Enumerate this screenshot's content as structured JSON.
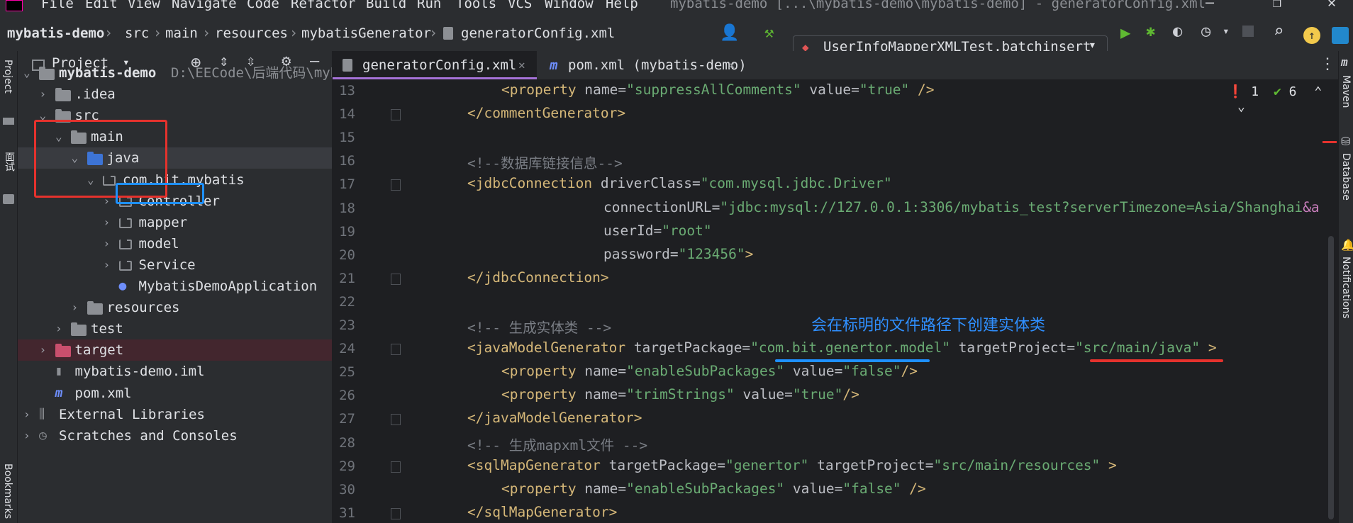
{
  "menu": [
    "File",
    "Edit",
    "View",
    "Navigate",
    "Code",
    "Refactor",
    "Build",
    "Run",
    "Tools",
    "VCS",
    "Window",
    "Help"
  ],
  "window_title": "mybatis-demo [...\\mybatis-demo\\mybatis-demo] - generatorConfig.xml",
  "breadcrumbs": [
    "mybatis-demo",
    "src",
    "main",
    "resources",
    "mybatisGenerator",
    "generatorConfig.xml"
  ],
  "run_config": "UserInfoMapperXMLTest.batchinsert",
  "left_strip": {
    "project": "Project",
    "bookmarks": "Bookmarks",
    "other": "面试"
  },
  "project_panel": {
    "title": "Project",
    "tree": [
      {
        "label": "mybatis-demo",
        "path": "D:\\EECode\\后端代码\\myb",
        "depth": 0,
        "expanded": true,
        "icon": "module-folder-icon"
      },
      {
        "label": ".idea",
        "depth": 1,
        "expanded": false,
        "icon": "folder-icon"
      },
      {
        "label": "src",
        "depth": 1,
        "expanded": true,
        "icon": "folder-icon"
      },
      {
        "label": "main",
        "depth": 2,
        "expanded": true,
        "icon": "folder-icon"
      },
      {
        "label": "java",
        "depth": 3,
        "expanded": true,
        "icon": "source-folder-icon"
      },
      {
        "label": "com.bit.mybatis",
        "depth": 4,
        "expanded": true,
        "icon": "package-icon"
      },
      {
        "label": "Controller",
        "depth": 5,
        "expanded": false,
        "icon": "package-icon"
      },
      {
        "label": "mapper",
        "depth": 5,
        "expanded": false,
        "icon": "package-icon"
      },
      {
        "label": "model",
        "depth": 5,
        "expanded": false,
        "icon": "package-icon"
      },
      {
        "label": "Service",
        "depth": 5,
        "expanded": false,
        "icon": "package-icon"
      },
      {
        "label": "MybatisDemoApplication",
        "depth": 5,
        "expanded": null,
        "icon": "spring-class-icon"
      },
      {
        "label": "resources",
        "depth": 3,
        "expanded": false,
        "icon": "resources-folder-icon"
      },
      {
        "label": "test",
        "depth": 2,
        "expanded": false,
        "icon": "folder-icon"
      },
      {
        "label": "target",
        "depth": 1,
        "expanded": false,
        "icon": "excluded-folder-icon"
      },
      {
        "label": "mybatis-demo.iml",
        "depth": 1,
        "expanded": null,
        "icon": "iml-file-icon"
      },
      {
        "label": "pom.xml",
        "depth": 1,
        "expanded": null,
        "icon": "maven-icon"
      },
      {
        "label": "External Libraries",
        "depth": 0,
        "expanded": false,
        "icon": "libraries-icon"
      },
      {
        "label": "Scratches and Consoles",
        "depth": 0,
        "expanded": false,
        "icon": "scratches-icon"
      }
    ]
  },
  "tabs": [
    {
      "label": "generatorConfig.xml",
      "active": true
    },
    {
      "label": "pom.xml (mybatis-demo)",
      "active": false
    }
  ],
  "inspections": {
    "errors": "1",
    "warnings": "6"
  },
  "code_lines": [
    {
      "n": "13",
      "indent": 2,
      "parts": [
        [
          "t",
          "<property "
        ],
        [
          "a",
          "name="
        ],
        [
          "v",
          "\"suppressAllComments\""
        ],
        [
          "a",
          " value="
        ],
        [
          "v",
          "\"true\""
        ],
        [
          "t",
          " />"
        ]
      ]
    },
    {
      "n": "14",
      "indent": 1,
      "parts": [
        [
          "t",
          "</commentGenerator>"
        ]
      ]
    },
    {
      "n": "15",
      "indent": 0,
      "parts": []
    },
    {
      "n": "16",
      "indent": 1,
      "parts": [
        [
          "c",
          "<!--数据库链接信息-->"
        ]
      ]
    },
    {
      "n": "17",
      "indent": 1,
      "parts": [
        [
          "t",
          "<jdbcConnection "
        ],
        [
          "a",
          "driverClass="
        ],
        [
          "v",
          "\"com.mysql.jdbc.Driver\""
        ]
      ]
    },
    {
      "n": "18",
      "indent": 5,
      "parts": [
        [
          "a",
          "connectionURL="
        ],
        [
          "v",
          "\"jdbc:mysql://127.0.0.1:3306/mybatis_test?serverTimezone=Asia/Shanghai"
        ],
        [
          "e",
          "&a"
        ]
      ]
    },
    {
      "n": "19",
      "indent": 5,
      "parts": [
        [
          "a",
          "userId="
        ],
        [
          "v",
          "\"root\""
        ]
      ]
    },
    {
      "n": "20",
      "indent": 5,
      "parts": [
        [
          "a",
          "password="
        ],
        [
          "v",
          "\"123456\""
        ],
        [
          "t",
          ">"
        ]
      ]
    },
    {
      "n": "21",
      "indent": 1,
      "parts": [
        [
          "t",
          "</jdbcConnection>"
        ]
      ]
    },
    {
      "n": "22",
      "indent": 0,
      "parts": []
    },
    {
      "n": "23",
      "indent": 1,
      "parts": [
        [
          "c",
          "<!-- 生成实体类 -->"
        ]
      ]
    },
    {
      "n": "24",
      "indent": 1,
      "parts": [
        [
          "t",
          "<javaModelGenerator "
        ],
        [
          "a",
          "targetPackage="
        ],
        [
          "v",
          "\"com.bit.genertor.model\""
        ],
        [
          "a",
          " targetProject="
        ],
        [
          "v",
          "\"src/main/java\""
        ],
        [
          "t",
          " >"
        ]
      ]
    },
    {
      "n": "25",
      "indent": 2,
      "parts": [
        [
          "t",
          "<property "
        ],
        [
          "a",
          "name="
        ],
        [
          "v",
          "\"enableSubPackages\""
        ],
        [
          "a",
          " value="
        ],
        [
          "v",
          "\"false\""
        ],
        [
          "t",
          "/>"
        ]
      ]
    },
    {
      "n": "26",
      "indent": 2,
      "parts": [
        [
          "t",
          "<property "
        ],
        [
          "a",
          "name="
        ],
        [
          "v",
          "\"trimStrings\""
        ],
        [
          "a",
          " value="
        ],
        [
          "v",
          "\"true\""
        ],
        [
          "t",
          "/>"
        ]
      ]
    },
    {
      "n": "27",
      "indent": 1,
      "parts": [
        [
          "t",
          "</javaModelGenerator>"
        ]
      ]
    },
    {
      "n": "28",
      "indent": 1,
      "parts": [
        [
          "c",
          "<!-- 生成mapxml文件 -->"
        ]
      ]
    },
    {
      "n": "29",
      "indent": 1,
      "parts": [
        [
          "t",
          "<sqlMapGenerator "
        ],
        [
          "a",
          "targetPackage="
        ],
        [
          "v",
          "\"genertor\""
        ],
        [
          "a",
          " targetProject="
        ],
        [
          "v",
          "\"src/main/resources\""
        ],
        [
          "t",
          " >"
        ]
      ]
    },
    {
      "n": "30",
      "indent": 2,
      "parts": [
        [
          "t",
          "<property "
        ],
        [
          "a",
          "name="
        ],
        [
          "v",
          "\"enableSubPackages\""
        ],
        [
          "a",
          " value="
        ],
        [
          "v",
          "\"false\""
        ],
        [
          "t",
          " />"
        ]
      ]
    },
    {
      "n": "31",
      "indent": 1,
      "parts": [
        [
          "t",
          "</sqlMapGenerator>"
        ]
      ]
    }
  ],
  "annotation_text": "会在标明的文件路径下创建实体类",
  "right_strip": {
    "maven": "Maven",
    "database": "Database",
    "notifications": "Notifications"
  },
  "colors": {
    "annotation_red": "#e5322d",
    "annotation_blue": "#1e90ff",
    "annotation_text": "#2f8fff"
  }
}
